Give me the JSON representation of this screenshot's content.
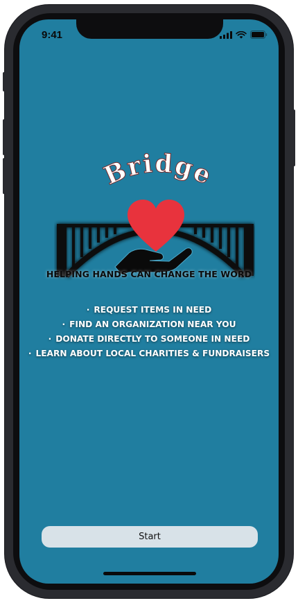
{
  "status_bar": {
    "time": "9:41"
  },
  "logo": {
    "wordmark": "Bridge",
    "heart_color": "#e8333d"
  },
  "tagline": "HELPING HANDS CAN CHANGE THE WORD",
  "features": [
    "REQUEST ITEMS IN NEED",
    "FIND AN ORGANIZATION NEAR YOU",
    "DONATE DIRECTLY TO SOMEONE IN NEED",
    "LEARN ABOUT LOCAL CHARITIES & FUNDRAISERS"
  ],
  "bullet_char": "·",
  "start_button": {
    "label": "Start"
  },
  "colors": {
    "background": "#207ea0",
    "button": "#d8e2e8"
  }
}
